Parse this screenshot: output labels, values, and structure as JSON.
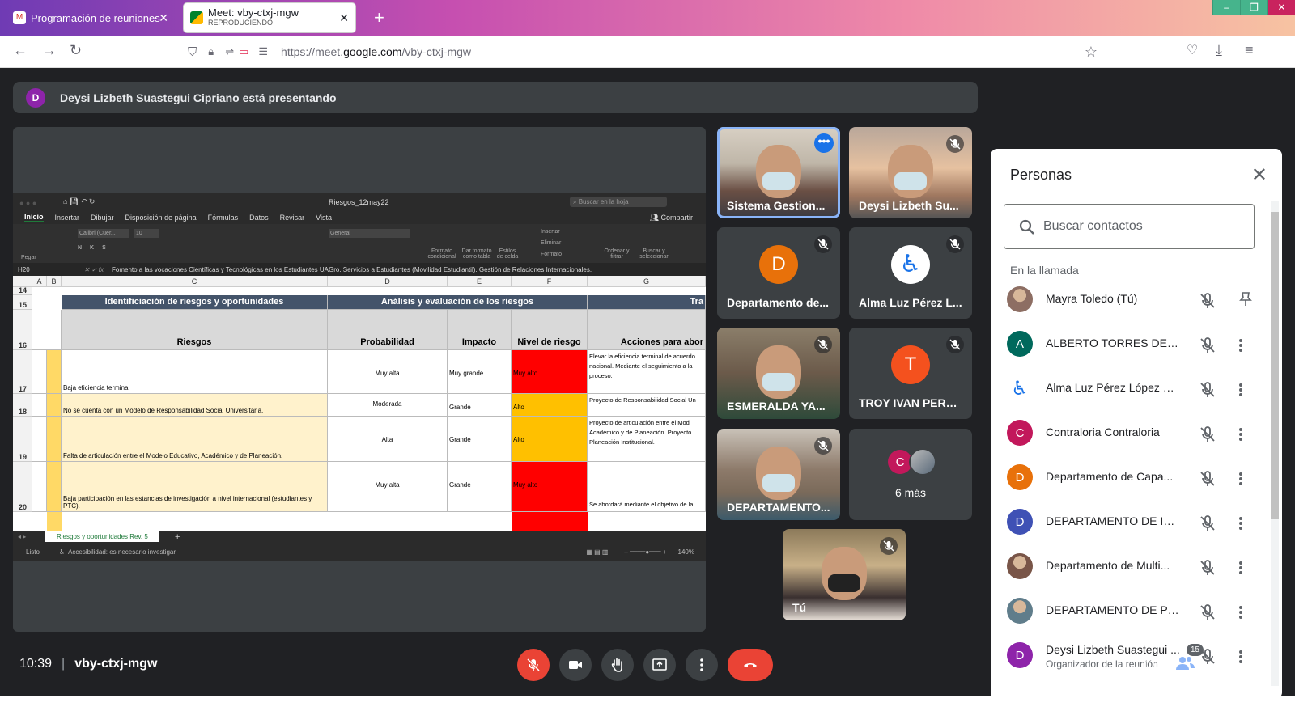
{
  "browser": {
    "tabs": [
      {
        "title": "Programación de reuniones - m",
        "active": false
      },
      {
        "title": "Meet: vby-ctxj-mgw",
        "subtitle": "REPRODUCIENDO",
        "active": true
      }
    ],
    "new_tab": "+",
    "url_prefix": "https://meet.",
    "url_host": "google.com",
    "url_path": "/vby-ctxj-mgw"
  },
  "meet": {
    "presenter_initial": "D",
    "presenter_banner": "Deysi Lizbeth Suastegui Cipriano está presentando",
    "time": "10:39",
    "meeting_code": "vby-ctxj-mgw",
    "participant_count": "15",
    "colors": {
      "bg": "#202124",
      "tile": "#3c4043",
      "end_call": "#ea4335",
      "accent": "#1a73e8"
    }
  },
  "excel": {
    "title": "Riesgos_12may22",
    "search_placeholder": "Buscar en la hoja",
    "share": "Compartir",
    "tabs": [
      "Inicio",
      "Insertar",
      "Dibujar",
      "Disposición de página",
      "Fórmulas",
      "Datos",
      "Revisar",
      "Vista"
    ],
    "ribbon": {
      "paste": "Pegar",
      "font": "Calibri (Cuer...",
      "size": "10",
      "number_format": "General",
      "cond_format": "Formato condicional",
      "table_format": "Dar formato como tabla",
      "cell_styles": "Estilos de celda",
      "insert": "Insertar",
      "delete": "Eliminar",
      "format": "Formato",
      "sort": "Ordenar y filtrar",
      "find": "Buscar y seleccionar"
    },
    "cell_ref": "H20",
    "formula": "Fomento a las vocaciones Científicas y Tecnológicas en los Estudiantes UAGro. Servicios a Estudiantes (Movilidad Estudiantil). Gestión de Relaciones Internacionales.",
    "columns": [
      "A",
      "B",
      "C",
      "D",
      "E",
      "F",
      "G"
    ],
    "header_row_15": {
      "c": "Identificiación de riesgos y oportunidades",
      "d": "Análisis y evaluación de los riesgos",
      "g": "Tra"
    },
    "header_row_16": {
      "c": "Riesgos",
      "d": "Probabilidad",
      "e": "Impacto",
      "f": "Nivel de riesgo",
      "g": "Acciones para abor"
    },
    "rows": [
      {
        "num": "17",
        "riesgo": "Baja eficiencia terminal",
        "prob": "Muy alta",
        "impacto": "Muy grande",
        "nivel": "Muy alto",
        "nivel_color": "#ff0000",
        "accion": "Elevar la eficiencia terminal de acuerdo nacional. Mediante el seguimiento a la proceso."
      },
      {
        "num": "18",
        "riesgo": "No se cuenta con un Modelo de Responsabilidad Social Universitaria.",
        "prob": "Moderada",
        "impacto": "Grande",
        "nivel": "Alto",
        "nivel_color": "#ffc000",
        "accion": "Proyecto de Responsabilidad Social Un"
      },
      {
        "num": "19",
        "riesgo": "Falta de articulación entre el Modelo Educativo, Académico y de Planeación.",
        "prob": "Alta",
        "impacto": "Grande",
        "nivel": "Alto",
        "nivel_color": "#ffc000",
        "accion": "Proyecto de articulación entre el Mod Académico y de Planeación. Proyecto Planeación Institucional."
      },
      {
        "num": "20",
        "riesgo": "Baja participación en las estancias de investigación a nivel internacional (estudiantes y PTC).",
        "prob": "Muy alta",
        "impacto": "Grande",
        "nivel": "Muy alto",
        "nivel_color": "#ff0000",
        "accion": "Se abordará mediante el objetivo de la"
      }
    ],
    "row_14": "14",
    "row_15": "15",
    "row_16": "16",
    "sheet_tab": "Riesgos y oportunidades Rev. 5",
    "status_ready": "Listo",
    "status_access": "Accesibilidad: es necesario investigar",
    "zoom": "140%"
  },
  "tiles": [
    {
      "name": "Sistema Gestion...",
      "type": "video"
    },
    {
      "name": "Deysi Lizbeth Su...",
      "type": "video"
    },
    {
      "name": "Departamento de...",
      "type": "avatar",
      "initial": "D",
      "color": "#e8710a"
    },
    {
      "name": "Alma Luz Pérez L...",
      "type": "icon"
    },
    {
      "name": "ESMERALDA YA...",
      "type": "video"
    },
    {
      "name": "TROY IVAN PEREZ...",
      "type": "avatar",
      "initial": "T",
      "color": "#f4511e"
    },
    {
      "name": "DEPARTAMENTO...",
      "type": "video"
    },
    {
      "name": "6 más",
      "type": "more",
      "initial": "C"
    },
    {
      "name": "Tú",
      "type": "video"
    }
  ],
  "people_panel": {
    "title": "Personas",
    "search_placeholder": "Buscar contactos",
    "section": "En la llamada",
    "people": [
      {
        "name": "Mayra Toledo (Tú)",
        "initial": "",
        "color": "#8d6e63",
        "photo": true
      },
      {
        "name": "ALBERTO TORRES DEL V...",
        "initial": "A",
        "color": "#00695c"
      },
      {
        "name": "Alma Luz Pérez López G...",
        "initial": "",
        "color": "#1a73e8",
        "icon": true
      },
      {
        "name": "Contraloria Contraloria",
        "initial": "C",
        "color": "#c2185b"
      },
      {
        "name": "Departamento de Capa...",
        "initial": "D",
        "color": "#e8710a"
      },
      {
        "name": "DEPARTAMENTO DE INF...",
        "initial": "D",
        "color": "#3f51b5"
      },
      {
        "name": "Departamento de Multi...",
        "initial": "",
        "color": "#795548",
        "photo": true
      },
      {
        "name": "DEPARTAMENTO DE PL...",
        "initial": "",
        "color": "#607d8b",
        "photo": true
      },
      {
        "name": "Deysi Lizbeth Suastegui ...",
        "sub": "Organizador de la reunión",
        "initial": "D",
        "color": "#8e24aa"
      }
    ]
  }
}
